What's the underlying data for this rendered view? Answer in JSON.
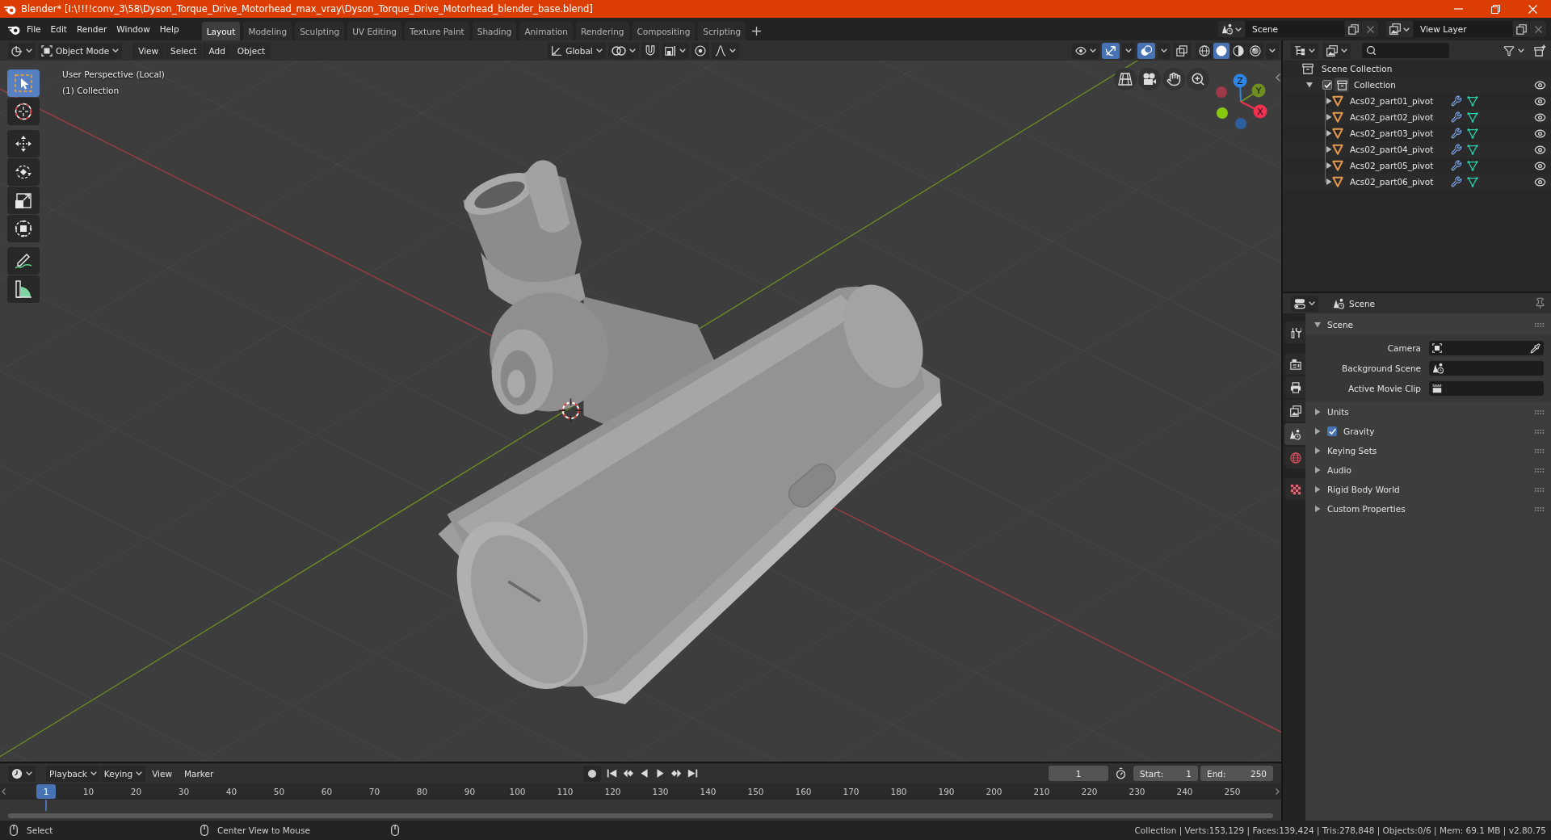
{
  "window": {
    "title": "Blender* [I:\\!!!!conv_3\\58\\Dyson_Torque_Drive_Motorhead_max_vray\\Dyson_Torque_Drive_Motorhead_blender_base.blend]"
  },
  "menu": [
    "File",
    "Edit",
    "Render",
    "Window",
    "Help"
  ],
  "workspaces": [
    {
      "label": "Layout",
      "selected": true
    },
    {
      "label": "Modeling",
      "selected": false
    },
    {
      "label": "Sculpting",
      "selected": false
    },
    {
      "label": "UV Editing",
      "selected": false
    },
    {
      "label": "Texture Paint",
      "selected": false
    },
    {
      "label": "Shading",
      "selected": false
    },
    {
      "label": "Animation",
      "selected": false
    },
    {
      "label": "Rendering",
      "selected": false
    },
    {
      "label": "Compositing",
      "selected": false
    },
    {
      "label": "Scripting",
      "selected": false
    }
  ],
  "scene": {
    "value": "Scene"
  },
  "view_layer": {
    "value": "View Layer"
  },
  "viewport": {
    "mode": "Object Mode",
    "menus": [
      "View",
      "Select",
      "Add",
      "Object"
    ],
    "orientation": "Global",
    "toggles": [
      {
        "kind": "snap",
        "on": false
      },
      {
        "kind": "proportional",
        "on": false
      },
      {
        "kind": "gizmos",
        "on": true
      },
      {
        "kind": "overlays",
        "on": true
      },
      {
        "kind": "xray",
        "on": false
      }
    ],
    "shading": [
      {
        "kind": "wireframe",
        "selected": false
      },
      {
        "kind": "solid",
        "selected": true
      },
      {
        "kind": "material",
        "selected": false
      },
      {
        "kind": "rendered",
        "selected": false
      }
    ],
    "info": [
      "User Perspective (Local)",
      "(1) Collection"
    ],
    "tools": [
      {
        "kind": "select_box",
        "selected": true
      },
      {
        "kind": "cursor",
        "selected": false
      },
      {
        "kind": "move",
        "selected": false
      },
      {
        "kind": "rotate",
        "selected": false
      },
      {
        "kind": "scale",
        "selected": false
      },
      {
        "kind": "transform",
        "selected": false
      },
      {
        "kind": "annotate",
        "selected": false
      },
      {
        "kind": "measure",
        "selected": false
      }
    ],
    "axes": [
      {
        "label": "Z",
        "color": "#2f86e6"
      },
      {
        "label": "Y",
        "color": "#6f8f22"
      },
      {
        "label": "X",
        "color": "#f2304f"
      }
    ]
  },
  "outliner": {
    "root": "Scene Collection",
    "collections": [
      {
        "label": "Collection",
        "checked": true,
        "expanded": true,
        "visible": true,
        "children": [
          {
            "label": "Acs02_part01_pivot",
            "expanded": false,
            "visible": true
          },
          {
            "label": "Acs02_part02_pivot",
            "expanded": false,
            "visible": true
          },
          {
            "label": "Acs02_part03_pivot",
            "expanded": false,
            "visible": true
          },
          {
            "label": "Acs02_part04_pivot",
            "expanded": false,
            "visible": true
          },
          {
            "label": "Acs02_part05_pivot",
            "expanded": false,
            "visible": true
          },
          {
            "label": "Acs02_part06_pivot",
            "expanded": false,
            "visible": true
          }
        ]
      }
    ]
  },
  "properties": {
    "context": "Scene",
    "tabs": [
      {
        "kind": "tool",
        "selected": false
      },
      {
        "kind": "render",
        "selected": false
      },
      {
        "kind": "output",
        "selected": false
      },
      {
        "kind": "view_layer",
        "selected": false
      },
      {
        "kind": "scene",
        "selected": true
      },
      {
        "kind": "world",
        "selected": false
      },
      {
        "kind": "texture",
        "selected": false
      }
    ],
    "panels": [
      {
        "title": "Scene",
        "kind": "plain",
        "expanded": true,
        "fields": [
          {
            "label": "Camera",
            "kind": "camera"
          },
          {
            "label": "Background Scene",
            "kind": "scene"
          },
          {
            "label": "Active Movie Clip",
            "kind": "clip"
          }
        ]
      },
      {
        "title": "Units",
        "kind": "plain",
        "expanded": false
      },
      {
        "title": "Gravity",
        "kind": "checkbox",
        "checked": true,
        "expanded": false
      },
      {
        "title": "Keying Sets",
        "kind": "plain",
        "expanded": false
      },
      {
        "title": "Audio",
        "kind": "plain",
        "expanded": false
      },
      {
        "title": "Rigid Body World",
        "kind": "plain",
        "expanded": false
      },
      {
        "title": "Custom Properties",
        "kind": "plain",
        "expanded": false
      }
    ]
  },
  "timeline": {
    "menus": [
      {
        "label": "Playback",
        "kind": "dropdown"
      },
      {
        "label": "Keying",
        "kind": "dropdown"
      },
      {
        "label": "View",
        "kind": "menu"
      },
      {
        "label": "Marker",
        "kind": "menu"
      }
    ],
    "auto_keying": false,
    "current_frame": "1",
    "start": {
      "label": "Start:",
      "value": "1"
    },
    "end": {
      "label": "End:",
      "value": "250"
    },
    "playhead": "1",
    "ticks": [
      "10",
      "20",
      "30",
      "40",
      "50",
      "60",
      "70",
      "80",
      "90",
      "100",
      "110",
      "120",
      "130",
      "140",
      "150",
      "160",
      "170",
      "180",
      "190",
      "200",
      "210",
      "220",
      "230",
      "240",
      "250"
    ]
  },
  "status_bar": {
    "hints": [
      "Select",
      "Center View to Mouse"
    ],
    "stats": "Collection | Verts:153,129 | Faces:139,424 | Tris:278,848 | Objects:0/6 | Mem: 69.1 MB | v2.80.75"
  }
}
